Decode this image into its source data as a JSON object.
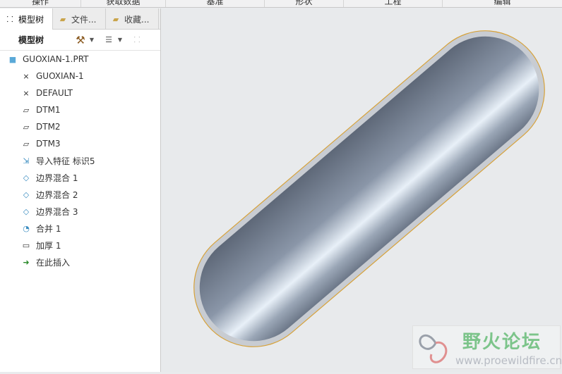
{
  "ribbon": [
    "操作",
    "获取数据",
    "基准",
    "形状",
    "工程",
    "编辑"
  ],
  "tabs": [
    {
      "label": "模型树"
    },
    {
      "label": "文件..."
    },
    {
      "label": "收藏..."
    }
  ],
  "toolbar": {
    "title": "模型树"
  },
  "tree": [
    {
      "label": "GUOXIAN-1.PRT",
      "icon": "part-icon"
    },
    {
      "label": "GUOXIAN-1",
      "icon": "csys-icon"
    },
    {
      "label": "DEFAULT",
      "icon": "csys-icon"
    },
    {
      "label": "DTM1",
      "icon": "datum-plane-icon"
    },
    {
      "label": "DTM2",
      "icon": "datum-plane-icon"
    },
    {
      "label": "DTM3",
      "icon": "datum-plane-icon"
    },
    {
      "label": "导入特征 标识5",
      "icon": "import-feature-icon"
    },
    {
      "label": "边界混合 1",
      "icon": "boundary-blend-icon"
    },
    {
      "label": "边界混合 2",
      "icon": "boundary-blend-icon"
    },
    {
      "label": "边界混合 3",
      "icon": "boundary-blend-icon"
    },
    {
      "label": "合并 1",
      "icon": "merge-icon"
    },
    {
      "label": "加厚 1",
      "icon": "thicken-icon"
    },
    {
      "label": "在此插入",
      "icon": "insert-arrow-icon"
    }
  ],
  "watermark": {
    "title": "野火论坛",
    "url": "www.proewildfire.cn"
  }
}
